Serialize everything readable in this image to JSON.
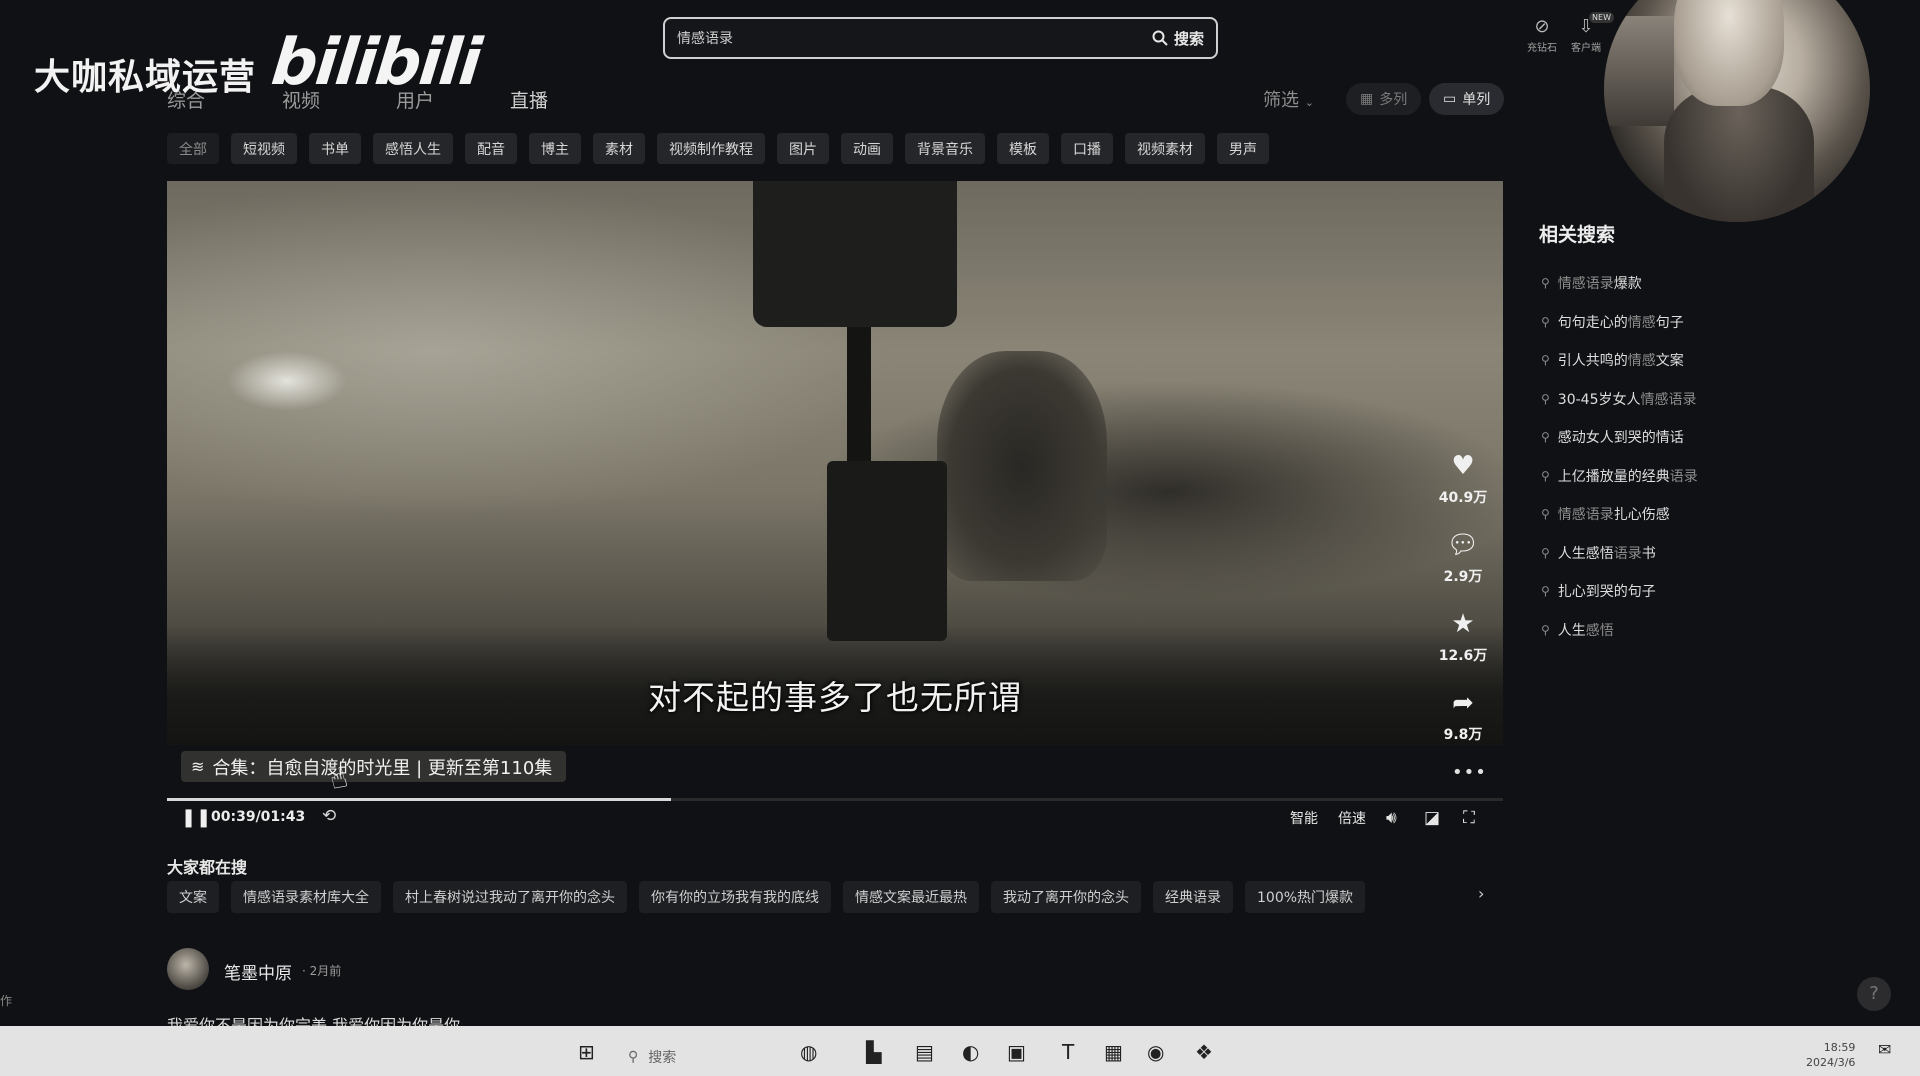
{
  "watermark": "大咖私域运营",
  "logo": "bilibili",
  "top_tabs": [
    "综合",
    "视频",
    "用户",
    "直播"
  ],
  "search": {
    "value": "情感语录",
    "button_label": "搜索"
  },
  "top_icons": [
    {
      "icon": "recharge-icon",
      "label": "充钻石"
    },
    {
      "icon": "download-icon",
      "label": "客户端",
      "badge": "NEW"
    }
  ],
  "filter_label": "筛选",
  "view_modes": {
    "multi": "多列",
    "single": "单列"
  },
  "category_chips": [
    "全部",
    "短视频",
    "书单",
    "感悟人生",
    "配音",
    "博主",
    "素材",
    "视频制作教程",
    "图片",
    "动画",
    "背景音乐",
    "模板",
    "口播",
    "视频素材",
    "男声"
  ],
  "video": {
    "subtitle": "对不起的事多了也无所谓",
    "collection": "合集：自愈自渡的时光里 | 更新至第110集",
    "time": "00:39/01:43",
    "progress": 0.377,
    "controls": {
      "smart": "智能",
      "speed": "倍速"
    },
    "actions": [
      {
        "icon": "heart-icon",
        "count": "40.9万"
      },
      {
        "icon": "comment-icon",
        "count": "2.9万"
      },
      {
        "icon": "star-icon",
        "count": "12.6万"
      },
      {
        "icon": "share-icon",
        "count": "9.8万"
      }
    ]
  },
  "hot": {
    "title": "大家都在搜",
    "items": [
      "文案",
      "情感语录素材库大全",
      "村上春树说过我动了离开你的念头",
      "你有你的立场我有我的底线",
      "情感文案最近最热",
      "我动了离开你的念头",
      "经典语录",
      "100%热门爆款"
    ]
  },
  "author": {
    "name": "笔墨中原",
    "time": "2月前",
    "caption": "我爱你不是因为你完美,我爱你因为你是你"
  },
  "related": {
    "title": "相关搜索",
    "items": [
      {
        "pre": "",
        "hl": "情感语录",
        "post": "爆款"
      },
      {
        "pre": "句句走心的",
        "hl": "情感",
        "post": "句子"
      },
      {
        "pre": "引人共鸣的",
        "hl": "情感",
        "post": "文案"
      },
      {
        "pre": "30-45岁女人",
        "hl": "情感语录",
        "post": ""
      },
      {
        "pre": "感动女人到哭的情话",
        "hl": "",
        "post": ""
      },
      {
        "pre": "上亿播放量的经典",
        "hl": "语录",
        "post": ""
      },
      {
        "pre": "",
        "hl": "情感语录",
        "post": "扎心伤感"
      },
      {
        "pre": "人生感悟",
        "hl": "语录",
        "post": "书"
      },
      {
        "pre": "扎心到哭的句子",
        "hl": "",
        "post": ""
      },
      {
        "pre": "人生",
        "hl": "感悟",
        "post": ""
      }
    ]
  },
  "help": "?",
  "left_mark": "作",
  "taskbar": {
    "search_placeholder": "搜索",
    "time": "18:59",
    "date": "2024/3/6"
  }
}
